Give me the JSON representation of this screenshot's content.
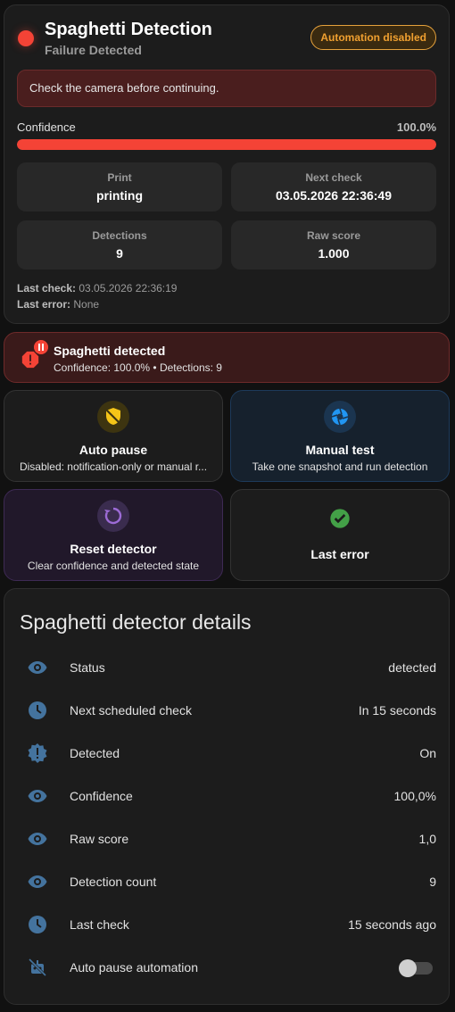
{
  "main": {
    "title": "Spaghetti Detection",
    "subtitle": "Failure Detected",
    "badge": "Automation disabled",
    "alert": "Check the camera before continuing.",
    "confidence_label": "Confidence",
    "confidence_value": "100.0%",
    "confidence_fraction": 1.0,
    "stats": [
      {
        "label": "Print",
        "value": "printing"
      },
      {
        "label": "Next check",
        "value": "03.05.2026 22:36:49"
      },
      {
        "label": "Detections",
        "value": "9"
      },
      {
        "label": "Raw score",
        "value": "1.000"
      }
    ],
    "last_check_label": "Last check:",
    "last_check_value": "03.05.2026 22:36:19",
    "last_error_label": "Last error:",
    "last_error_value": "None",
    "colors": {
      "status": "#f44336",
      "badge": "#f0a030"
    }
  },
  "spaghetti_alert": {
    "title": "Spaghetti detected",
    "subtitle": "Confidence: 100.0% • Detections: 9",
    "icon": "alert-octagon-icon",
    "badge_icon": "pause-icon"
  },
  "tiles": [
    {
      "title": "Auto pause",
      "subtitle": "Disabled: notification-only or manual r...",
      "icon": "shield-off-icon",
      "color": "#f5c518"
    },
    {
      "title": "Manual test",
      "subtitle": "Take one snapshot and run detection",
      "icon": "camera-iris-icon",
      "color": "#2196f3"
    },
    {
      "title": "Reset detector",
      "subtitle": "Clear confidence and detected state",
      "icon": "restore-icon",
      "color": "#9c6bd6"
    },
    {
      "title": "Last error",
      "subtitle": "",
      "icon": "check-circle-icon",
      "color": "#43a047"
    }
  ],
  "details": {
    "title": "Spaghetti detector details",
    "rows": [
      {
        "label": "Status",
        "value": "detected",
        "icon": "eye-icon"
      },
      {
        "label": "Next scheduled check",
        "value": "In 15 seconds",
        "icon": "clock-icon"
      },
      {
        "label": "Detected",
        "value": "On",
        "icon": "alert-decagram-icon"
      },
      {
        "label": "Confidence",
        "value": "100,0%",
        "icon": "eye-icon"
      },
      {
        "label": "Raw score",
        "value": "1,0",
        "icon": "eye-icon"
      },
      {
        "label": "Detection count",
        "value": "9",
        "icon": "eye-icon"
      },
      {
        "label": "Last check",
        "value": "15 seconds ago",
        "icon": "clock-icon"
      },
      {
        "label": "Auto pause automation",
        "value": "",
        "icon": "robot-off-icon",
        "toggle": false
      }
    ]
  }
}
